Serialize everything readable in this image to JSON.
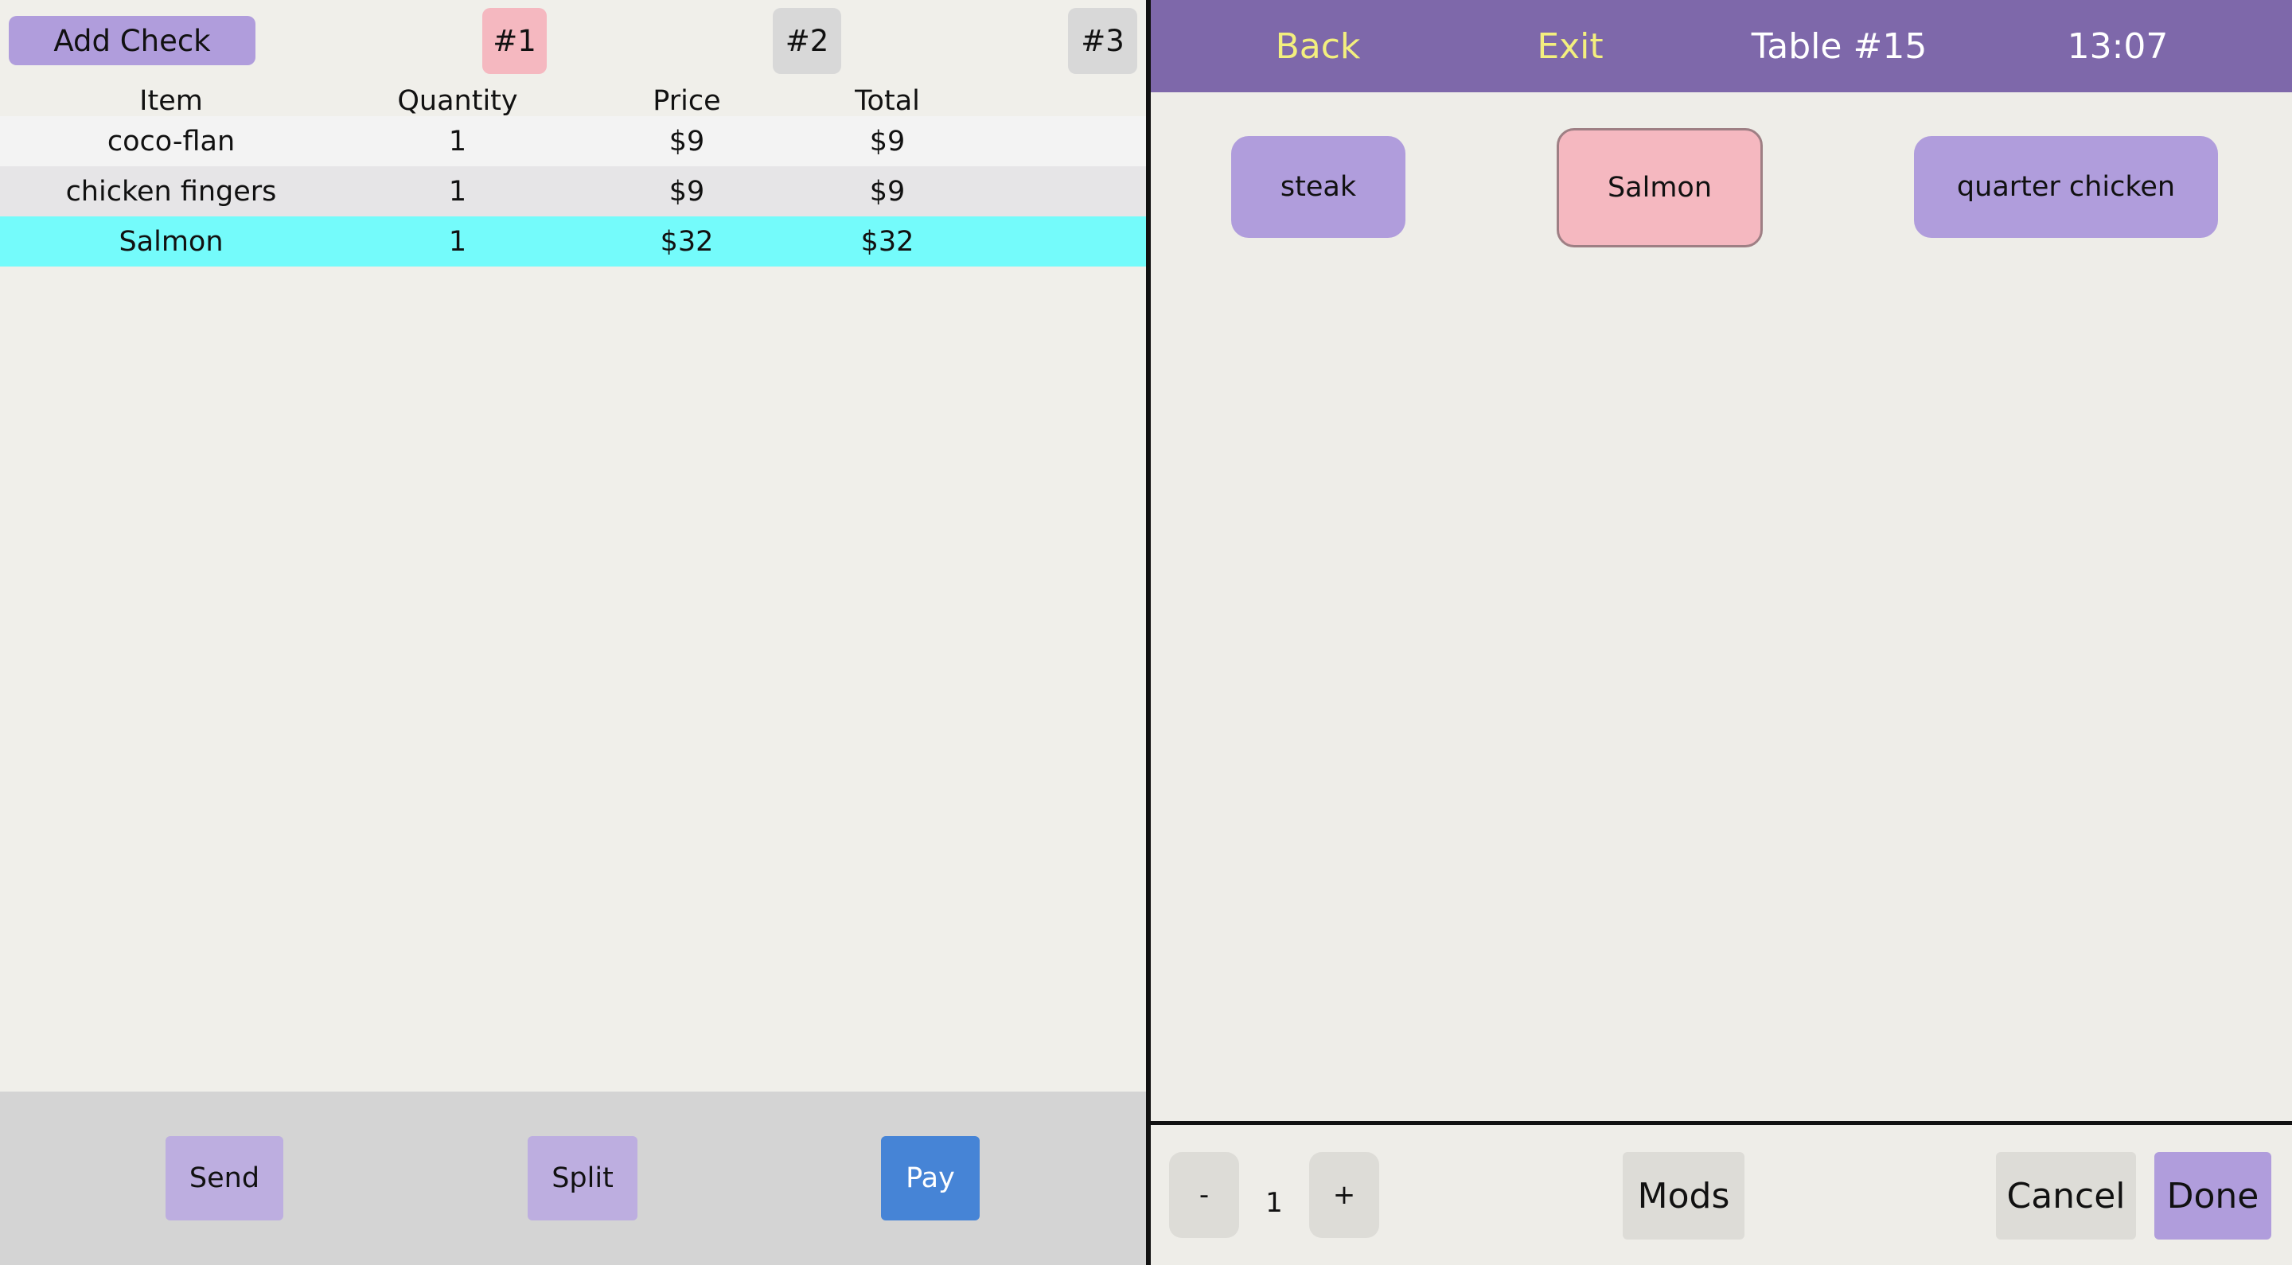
{
  "check": {
    "add_check_label": "Add Check",
    "tabs": [
      "#1",
      "#2",
      "#3"
    ],
    "columns": [
      "Item",
      "Quantity",
      "Price",
      "Total"
    ],
    "rows": [
      {
        "item": "coco-flan",
        "quantity": "1",
        "price": "$9",
        "total": "$9"
      },
      {
        "item": "chicken fingers",
        "quantity": "1",
        "price": "$9",
        "total": "$9"
      },
      {
        "item": "Salmon",
        "quantity": "1",
        "price": "$32",
        "total": "$32"
      }
    ],
    "actions": {
      "send": "Send",
      "split": "Split",
      "pay": "Pay"
    }
  },
  "header": {
    "back": "Back",
    "exit": "Exit",
    "table": "Table #15",
    "time": "13:07"
  },
  "menu": {
    "items": [
      "steak",
      "Salmon",
      "quarter chicken"
    ]
  },
  "footer": {
    "minus": "-",
    "quantity": "1",
    "plus": "+",
    "mods": "Mods",
    "cancel": "Cancel",
    "done": "Done"
  },
  "colors": {
    "accent_purple": "#b09ddc",
    "selected_pink": "#f5b8c0",
    "highlight_cyan": "#74fbfb",
    "pay_blue": "#4684d6",
    "header_purple": "#7e68aa",
    "header_link_yellow": "#f3ef7e"
  }
}
